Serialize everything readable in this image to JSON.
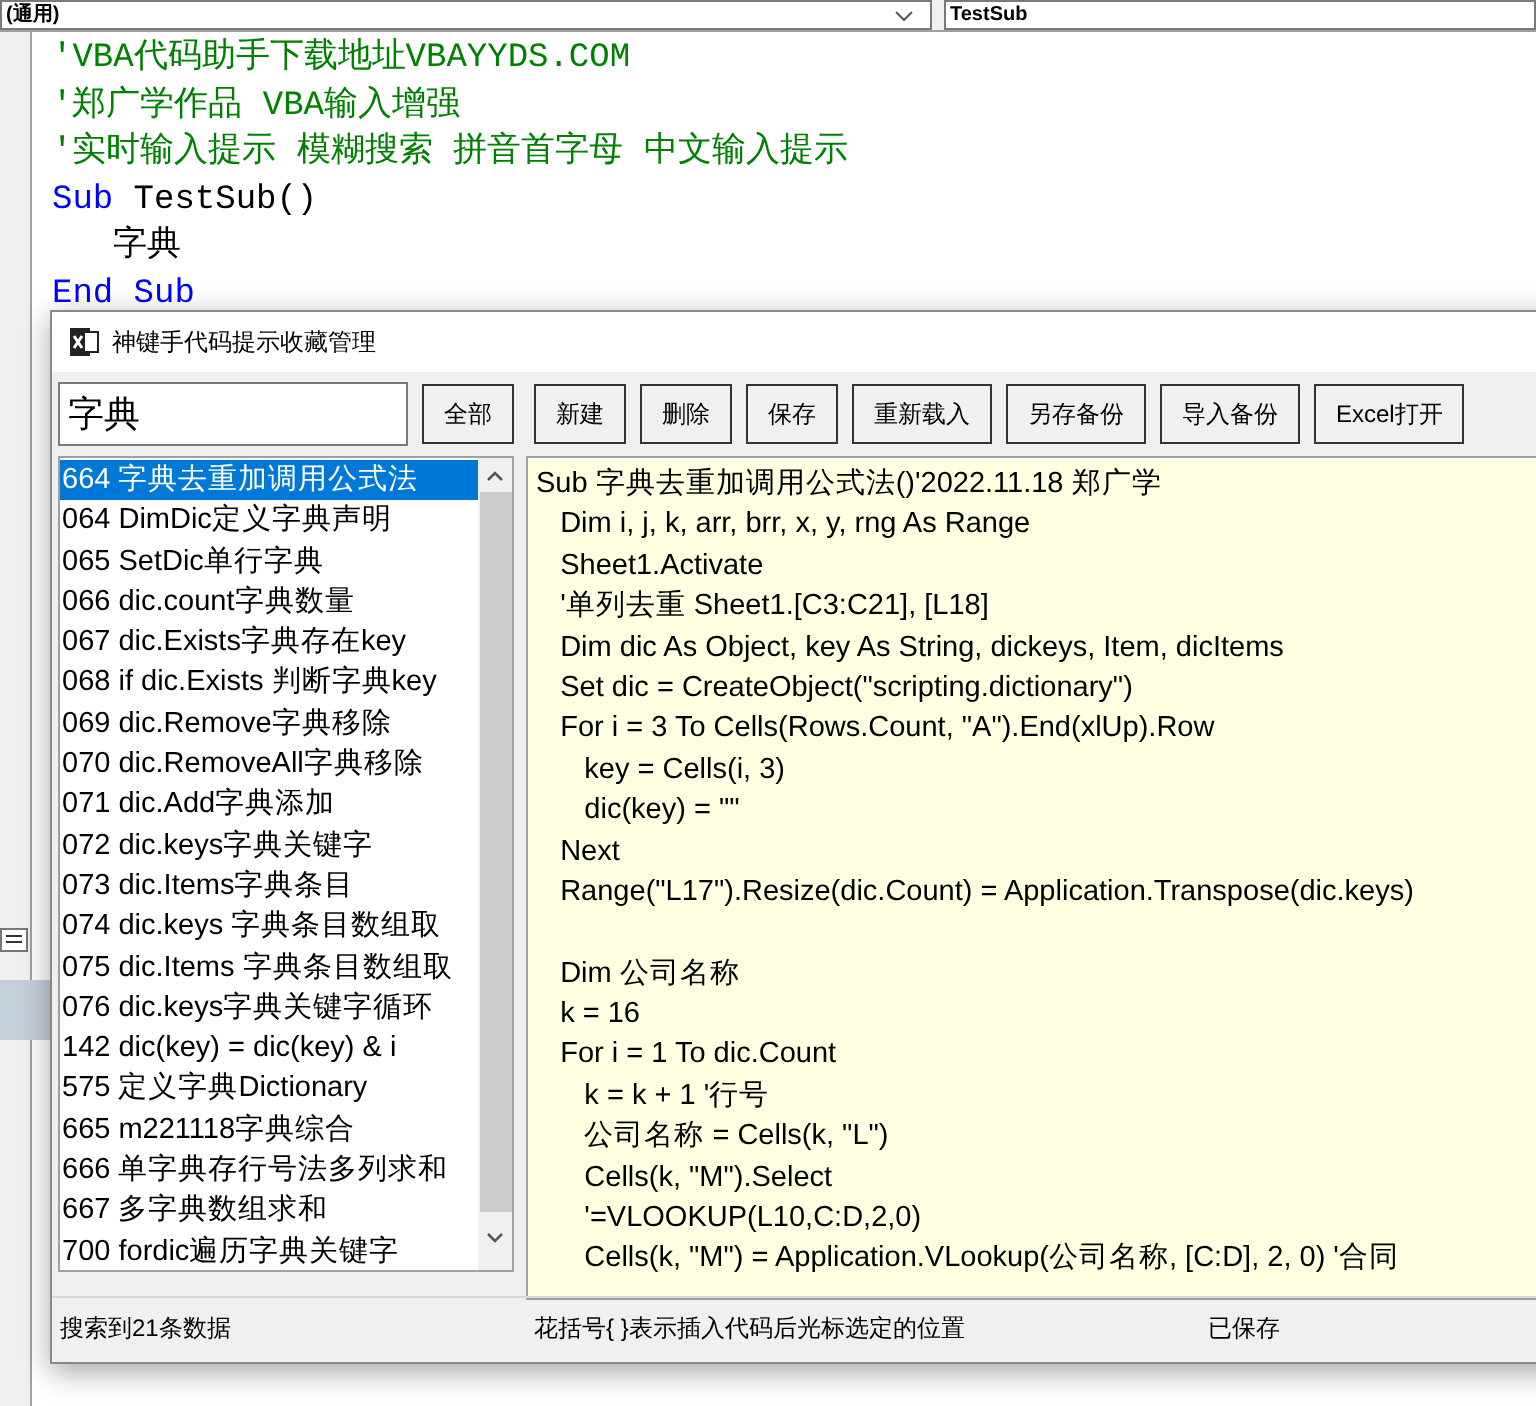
{
  "editor": {
    "procedure_dropdowns": [
      "(通用)",
      "TestSub"
    ],
    "lines": [
      {
        "tokens": [
          {
            "kind": "comment",
            "text": "'VBA代码助手下载地址VBAYYDS.COM"
          }
        ]
      },
      {
        "tokens": [
          {
            "kind": "comment",
            "text": "'郑广学作品 VBA输入增强"
          }
        ]
      },
      {
        "tokens": [
          {
            "kind": "comment",
            "text": "'实时输入提示 模糊搜索 拼音首字母 中文输入提示"
          }
        ]
      },
      {
        "tokens": [
          {
            "kind": "keyword",
            "text": "Sub"
          },
          {
            "kind": "plain",
            "text": " TestSub()"
          }
        ]
      },
      {
        "tokens": [
          {
            "kind": "plain",
            "text": "   字典"
          }
        ]
      },
      {
        "tokens": [
          {
            "kind": "keyword",
            "text": "End Sub"
          }
        ]
      }
    ]
  },
  "dialog": {
    "title": "神键手代码提示收藏管理",
    "search": {
      "value": "字典"
    },
    "buttons": [
      "全部",
      "新建",
      "删除",
      "保存",
      "重新载入",
      "另存备份",
      "导入备份",
      "Excel打开"
    ],
    "results": [
      {
        "label": "664 字典去重加调用公式法",
        "selected": true
      },
      {
        "label": "064 DimDic定义字典声明",
        "selected": false
      },
      {
        "label": "065 SetDic单行字典",
        "selected": false
      },
      {
        "label": "066 dic.count字典数量",
        "selected": false
      },
      {
        "label": "067 dic.Exists字典存在key",
        "selected": false
      },
      {
        "label": "068 if dic.Exists 判断字典key",
        "selected": false
      },
      {
        "label": "069 dic.Remove字典移除",
        "selected": false
      },
      {
        "label": "070 dic.RemoveAll字典移除",
        "selected": false
      },
      {
        "label": "071 dic.Add字典添加",
        "selected": false
      },
      {
        "label": "072 dic.keys字典关键字",
        "selected": false
      },
      {
        "label": "073 dic.Items字典条目",
        "selected": false
      },
      {
        "label": "074 dic.keys 字典条目数组取",
        "selected": false
      },
      {
        "label": "075 dic.Items 字典条目数组取",
        "selected": false
      },
      {
        "label": "076 dic.keys字典关键字循环",
        "selected": false
      },
      {
        "label": "142 dic(key) = dic(key) & i",
        "selected": false
      },
      {
        "label": "575 定义字典Dictionary",
        "selected": false
      },
      {
        "label": "665 m221118字典综合",
        "selected": false
      },
      {
        "label": "666 单字典存行号法多列求和",
        "selected": false
      },
      {
        "label": "667 多字典数组求和",
        "selected": false
      },
      {
        "label": "700 fordic遍历字典关键字",
        "selected": false
      }
    ],
    "code_blocks": [
      [
        "Sub 字典去重加调用公式法()'2022.11.18 郑广学",
        "   Dim i, j, k, arr, brr, x, y, rng As Range",
        "   Sheet1.Activate",
        "   '单列去重 Sheet1.[C3:C21], [L18]",
        "   Dim dic As Object, key As String, dickeys, Item, dicItems",
        "   Set dic = CreateObject(\"scripting.dictionary\")",
        "   For i = 3 To Cells(Rows.Count, \"A\").End(xlUp).Row",
        "      key = Cells(i, 3)",
        "      dic(key) = \"\"",
        "   Next",
        "   Range(\"L17\").Resize(dic.Count) = Application.Transpose(dic.keys)"
      ],
      [
        "   Dim 公司名称",
        "   k = 16",
        "   For i = 1 To dic.Count",
        "      k = k + 1 '行号",
        "      公司名称 = Cells(k, \"L\")",
        "      Cells(k, \"M\").Select",
        "      '=VLOOKUP(L10,C:D,2,0)",
        "      Cells(k, \"M\") = Application.VLookup(公司名称, [C:D], 2, 0) '合同"
      ]
    ],
    "status": {
      "count": "搜索到21条数据",
      "hint": "花括号{ }表示插入代码后光标选定的位置",
      "save_state": "已保存"
    }
  }
}
